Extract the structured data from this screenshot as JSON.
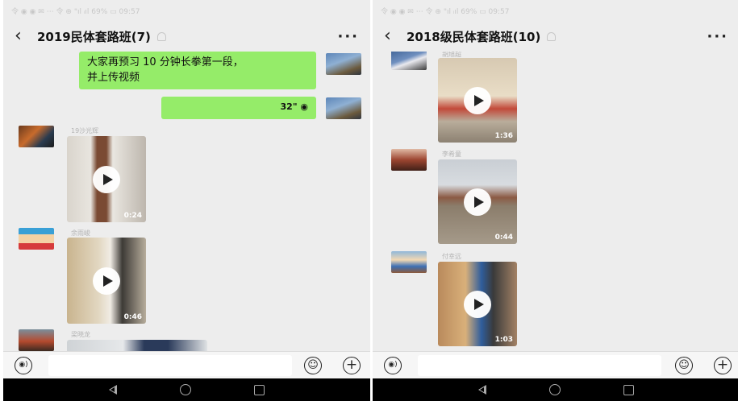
{
  "left_screen": {
    "status": "令 ◉ ◉ ✉ ⋯ 令 ⊕ \"ıl ᵢıl 69% ▭ 09:57",
    "back_icon": "back-arrow-icon",
    "title": "2019民体套路班(7)",
    "more": "···",
    "messages": {
      "outgoing_text": "大家再预习 10 分钟长拳第一段，\n并上传视频",
      "outgoing_voice": "32\" ◉"
    },
    "videos": [
      {
        "sender": "19沙光辉",
        "duration": "0:24"
      },
      {
        "sender": "余雨峻",
        "duration": "0:46"
      },
      {
        "sender": "梁晓龙",
        "duration": ""
      }
    ]
  },
  "right_screen": {
    "status": "令 ◉ ◉ ✉ ⋯ 令 ⊕ \"ıl ᵢıl 69% ▭ 09:57",
    "back_icon": "back-arrow-icon",
    "title": "2018级民体套路班(10)",
    "more": "···",
    "videos": [
      {
        "sender": "胡旭超",
        "duration": "1:36"
      },
      {
        "sender": "李希童",
        "duration": "0:44"
      },
      {
        "sender": "付幸远",
        "duration": "1:03"
      }
    ]
  },
  "input_bar": {
    "voice_icon": "voice-icon",
    "emoji_icon": "emoji-icon",
    "plus_icon": "plus-icon"
  },
  "colors": {
    "bubble_green": "#95ec69",
    "chat_bg": "#ededed"
  }
}
